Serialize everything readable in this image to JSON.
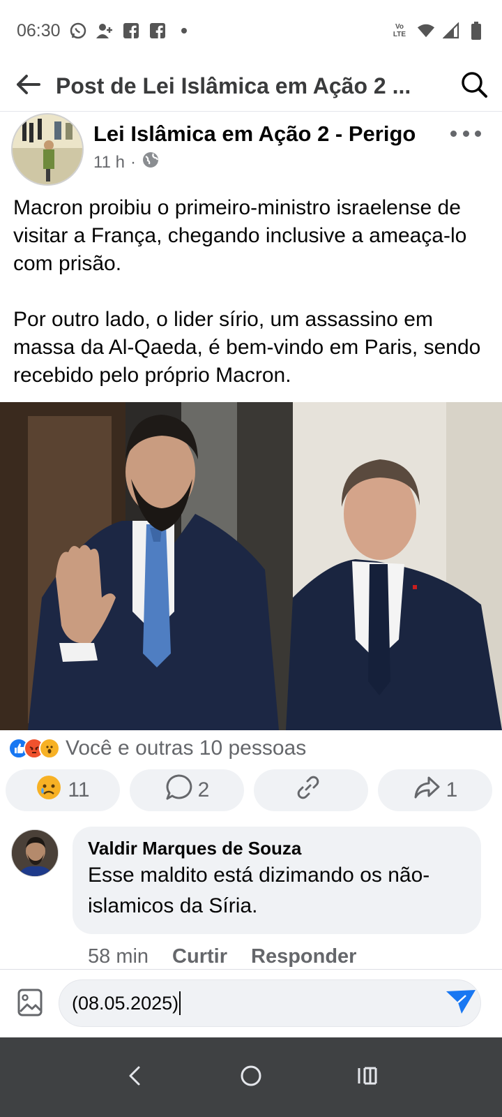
{
  "status_bar": {
    "time": "06:30",
    "left_icons": [
      "whatsapp-icon",
      "person-add-icon",
      "facebook-icon",
      "facebook-icon",
      "dot-icon"
    ],
    "network_label": "Vo LTE",
    "right_icons": [
      "volte-icon",
      "wifi-icon",
      "signal-icon",
      "battery-icon"
    ]
  },
  "top_bar": {
    "title": "Post de Lei Islâmica em Ação 2 ...",
    "back_icon": "arrow-left-icon",
    "search_icon": "search-icon"
  },
  "post": {
    "page_name": "Lei Islâmica em Ação 2 - Perigo",
    "time": "11 h",
    "separator": "·",
    "privacy_icon": "globe-icon",
    "text_paragraphs": [
      "Macron proibiu o primeiro-ministro israelense de visitar a França, chegando inclusive a ameaça-lo com prisão.",
      "Por outro lado, o lider sírio, um assassino em massa da Al-Qaeda, é bem-vindo em Paris, sendo recebido pelo próprio Macron."
    ]
  },
  "reactions": {
    "emojis": [
      "like",
      "angry",
      "wow"
    ],
    "summary": "Você e outras 10 pessoas"
  },
  "actions": [
    {
      "icon": "sad-emoji-icon",
      "label": "11"
    },
    {
      "icon": "comment-icon",
      "label": "2"
    },
    {
      "icon": "link-icon",
      "label": ""
    },
    {
      "icon": "share-icon",
      "label": "1"
    }
  ],
  "comment": {
    "author": "Valdir Marques de Souza",
    "text": "Esse maldito está dizimando os não-islamicos da Síria.",
    "time": "58 min",
    "like_label": "Curtir",
    "reply_label": "Responder"
  },
  "composer": {
    "value": "(08.05.2025)",
    "photo_icon": "image-icon",
    "send_icon": "send-icon"
  },
  "colors": {
    "accent": "#1877f2",
    "send": "#1877f2",
    "secondary_text": "#65676b",
    "pill_bg": "#f0f2f5",
    "nav_bar": "#3f4143"
  }
}
